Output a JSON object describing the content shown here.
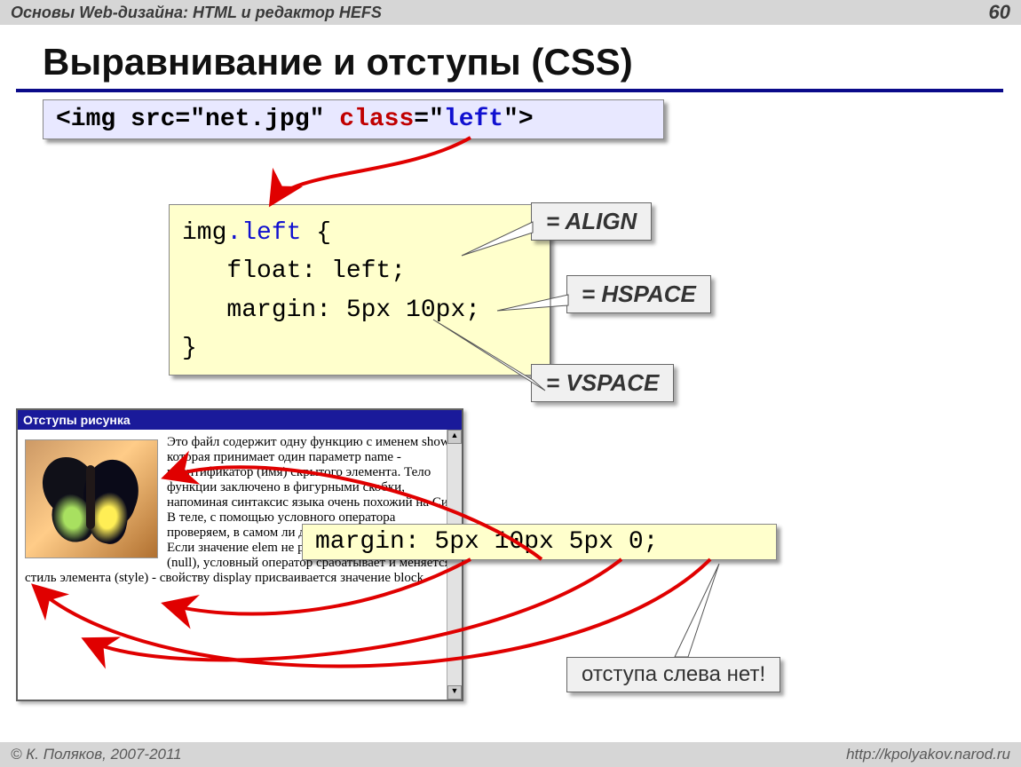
{
  "header": {
    "subject": "Основы Web-дизайна: HTML и редактор HEFS",
    "page": "60"
  },
  "title": "Выравнивание и отступы (CSS)",
  "code1": {
    "pre": "<img src=\"net.jpg\" ",
    "attr": "class",
    "eq": "=\"",
    "val": "left",
    "post": "\">"
  },
  "code2": {
    "line1a": "img",
    "line1b": ".left",
    "line1c": " {",
    "line2": "   float: left;",
    "line3": "   margin: 5px 10px;",
    "line4": "}"
  },
  "code3": "margin: 5px 10px 5px 0;",
  "labels": {
    "align": "= ALIGN",
    "hspace": "= HSPACE",
    "vspace": "= VSPACE",
    "noleft": "отступа слева нет!"
  },
  "browser": {
    "title": "Отступы рисунка",
    "text": "Это файл содержит одну функцию с именем show, которая принимает один параметр name - идентификатор (имя) скрытого элемента. Тело функции заключено в фигурными скобки, напоминая синтаксис языка очень похожий на Си. В теле, с помощью условного оператора проверяем, в самом ли деле такой элемент найден. Если значение elem не равно пустому значению (null), условный оператор срабатывает и меняется стиль элемента (style) - свойству display присваивается значение block."
  },
  "footer": {
    "copyright": "© К. Поляков, 2007-2011",
    "url": "http://kpolyakov.narod.ru"
  }
}
